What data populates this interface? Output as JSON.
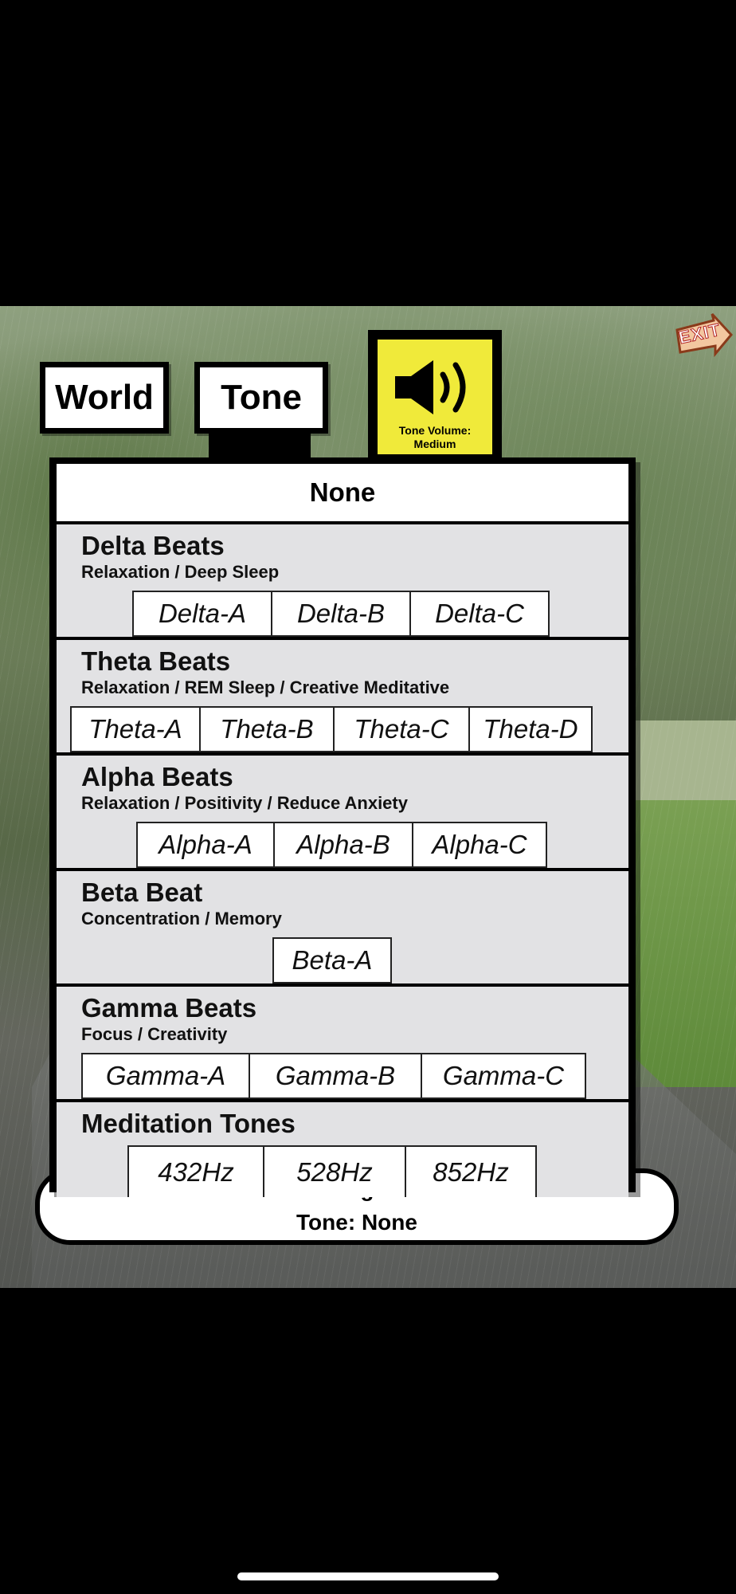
{
  "tabs": {
    "world": "World",
    "tone": "Tone"
  },
  "volume": {
    "label_line1": "Tone Volume:",
    "label_line2": "Medium",
    "icon": "speaker-icon"
  },
  "exit": {
    "label": "EXIT"
  },
  "tone_list": {
    "none_label": "None",
    "sections": [
      {
        "title": "Delta Beats",
        "subtitle": "Relaxation / Deep Sleep",
        "options": [
          "Delta-A",
          "Delta-B",
          "Delta-C"
        ]
      },
      {
        "title": "Theta Beats",
        "subtitle": "Relaxation / REM Sleep / Creative Meditative",
        "options": [
          "Theta-A",
          "Theta-B",
          "Theta-C",
          "Theta-D"
        ]
      },
      {
        "title": "Alpha Beats",
        "subtitle": "Relaxation / Positivity / Reduce Anxiety",
        "options": [
          "Alpha-A",
          "Alpha-B",
          "Alpha-C"
        ]
      },
      {
        "title": "Beta Beat",
        "subtitle": "Concentration / Memory",
        "options": [
          "Beta-A"
        ]
      },
      {
        "title": "Gamma Beats",
        "subtitle": "Focus / Creativity",
        "options": [
          "Gamma-A",
          "Gamma-B",
          "Gamma-C"
        ]
      },
      {
        "title": "Meditation Tones",
        "subtitle": "",
        "options": [
          "432Hz",
          "528Hz",
          "852Hz"
        ]
      }
    ]
  },
  "status": {
    "world_line": "World: Light Rain",
    "tone_line": "Tone: None"
  },
  "colors": {
    "volume_bg": "#f0ea3a",
    "panel_bg": "#e2e2e4"
  }
}
